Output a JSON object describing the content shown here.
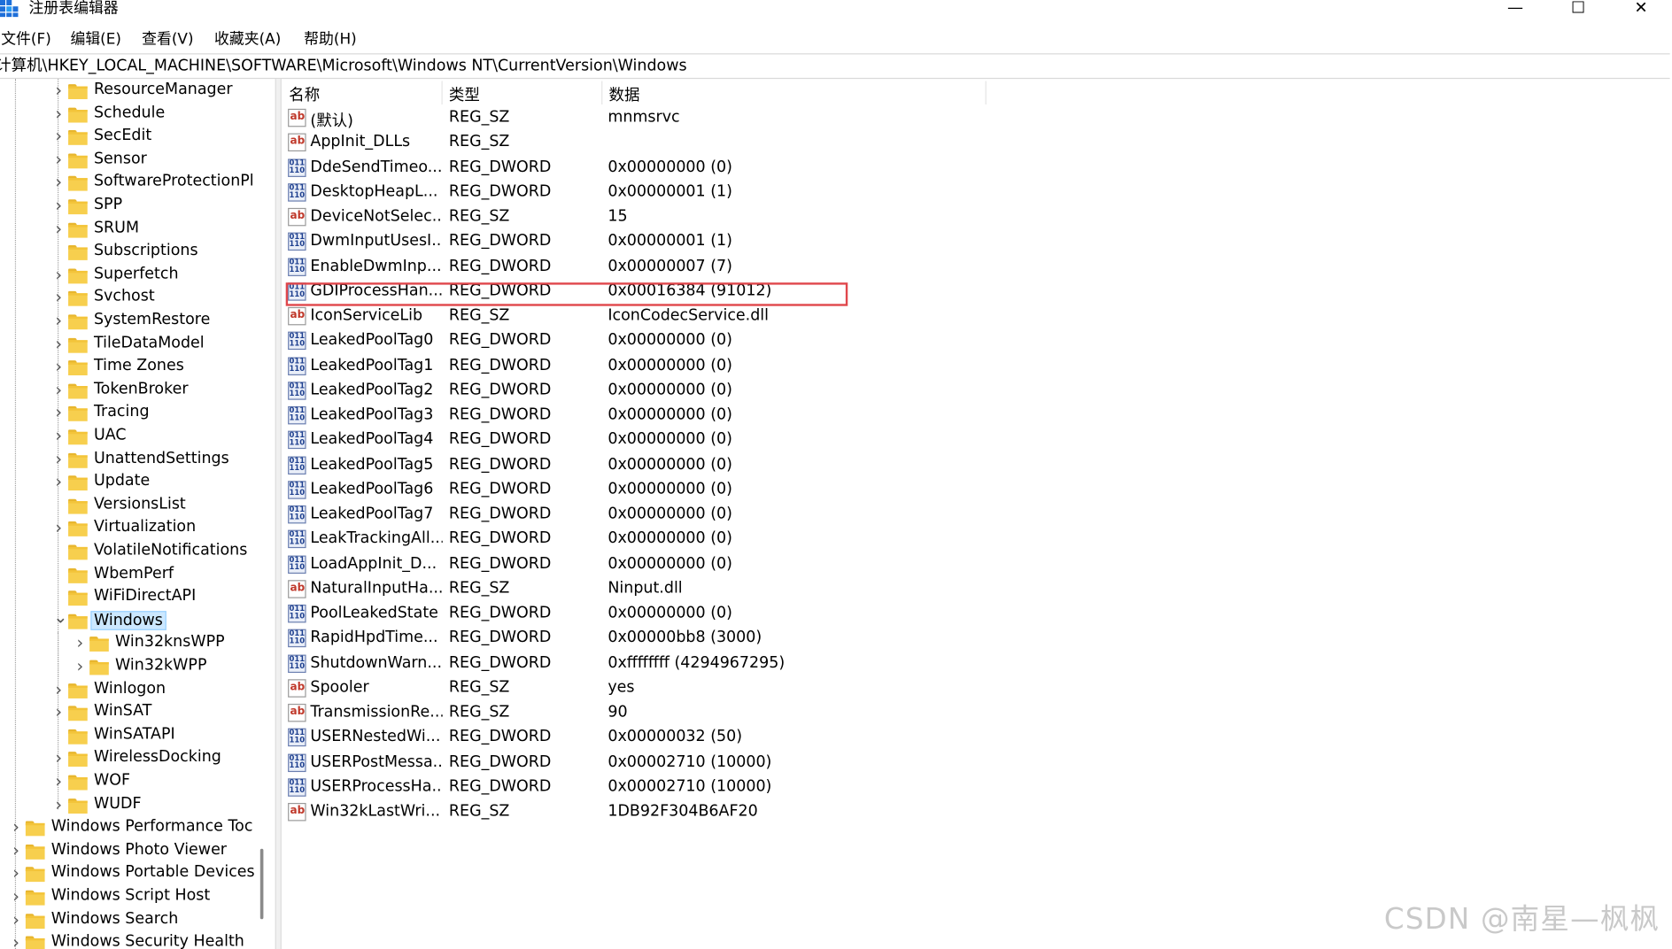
{
  "window": {
    "title": "注册表编辑器",
    "minimize": "—",
    "maximize": "☐",
    "close": "✕"
  },
  "menu": [
    "文件(F)",
    "编辑(E)",
    "查看(V)",
    "收藏夹(A)",
    "帮助(H)"
  ],
  "address": "计算机\\HKEY_LOCAL_MACHINE\\SOFTWARE\\Microsoft\\Windows NT\\CurrentVersion\\Windows",
  "tree": [
    {
      "label": "ResourceManager",
      "chev": ">",
      "indent": 1
    },
    {
      "label": "Schedule",
      "chev": ">",
      "indent": 1
    },
    {
      "label": "SecEdit",
      "chev": ">",
      "indent": 1
    },
    {
      "label": "Sensor",
      "chev": ">",
      "indent": 1
    },
    {
      "label": "SoftwareProtectionPl",
      "chev": ">",
      "indent": 1
    },
    {
      "label": "SPP",
      "chev": ">",
      "indent": 1
    },
    {
      "label": "SRUM",
      "chev": ">",
      "indent": 1
    },
    {
      "label": "Subscriptions",
      "chev": "",
      "indent": 1
    },
    {
      "label": "Superfetch",
      "chev": ">",
      "indent": 1
    },
    {
      "label": "Svchost",
      "chev": ">",
      "indent": 1
    },
    {
      "label": "SystemRestore",
      "chev": ">",
      "indent": 1
    },
    {
      "label": "TileDataModel",
      "chev": ">",
      "indent": 1
    },
    {
      "label": "Time Zones",
      "chev": ">",
      "indent": 1
    },
    {
      "label": "TokenBroker",
      "chev": ">",
      "indent": 1
    },
    {
      "label": "Tracing",
      "chev": ">",
      "indent": 1
    },
    {
      "label": "UAC",
      "chev": ">",
      "indent": 1
    },
    {
      "label": "UnattendSettings",
      "chev": ">",
      "indent": 1
    },
    {
      "label": "Update",
      "chev": ">",
      "indent": 1
    },
    {
      "label": "VersionsList",
      "chev": "",
      "indent": 1
    },
    {
      "label": "Virtualization",
      "chev": ">",
      "indent": 1
    },
    {
      "label": "VolatileNotifications",
      "chev": "",
      "indent": 1
    },
    {
      "label": "WbemPerf",
      "chev": "",
      "indent": 1
    },
    {
      "label": "WiFiDirectAPI",
      "chev": "",
      "indent": 1
    },
    {
      "label": "Windows",
      "chev": "v",
      "indent": 1,
      "selected": true
    },
    {
      "label": "Win32knsWPP",
      "chev": ">",
      "indent": 2
    },
    {
      "label": "Win32kWPP",
      "chev": ">",
      "indent": 2
    },
    {
      "label": "Winlogon",
      "chev": ">",
      "indent": 1
    },
    {
      "label": "WinSAT",
      "chev": ">",
      "indent": 1
    },
    {
      "label": "WinSATAPI",
      "chev": "",
      "indent": 1
    },
    {
      "label": "WirelessDocking",
      "chev": ">",
      "indent": 1
    },
    {
      "label": "WOF",
      "chev": ">",
      "indent": 1
    },
    {
      "label": "WUDF",
      "chev": ">",
      "indent": 1
    },
    {
      "label": "Windows Performance Toc",
      "chev": ">",
      "indent": 0
    },
    {
      "label": "Windows Photo Viewer",
      "chev": ">",
      "indent": 0
    },
    {
      "label": "Windows Portable Devices",
      "chev": ">",
      "indent": 0
    },
    {
      "label": "Windows Script Host",
      "chev": ">",
      "indent": 0
    },
    {
      "label": "Windows Search",
      "chev": ">",
      "indent": 0
    },
    {
      "label": "Windows Security Health",
      "chev": ">",
      "indent": 0
    }
  ],
  "columns": {
    "name": "名称",
    "type": "类型",
    "data": "数据"
  },
  "values": [
    {
      "name": "(默认)",
      "type": "REG_SZ",
      "data": "mnmsrvc",
      "icon": "sz"
    },
    {
      "name": "AppInit_DLLs",
      "type": "REG_SZ",
      "data": "",
      "icon": "sz"
    },
    {
      "name": "DdeSendTimeo...",
      "type": "REG_DWORD",
      "data": "0x00000000 (0)",
      "icon": "dw"
    },
    {
      "name": "DesktopHeapL...",
      "type": "REG_DWORD",
      "data": "0x00000001 (1)",
      "icon": "dw"
    },
    {
      "name": "DeviceNotSelec...",
      "type": "REG_SZ",
      "data": "15",
      "icon": "sz"
    },
    {
      "name": "DwmInputUsesI...",
      "type": "REG_DWORD",
      "data": "0x00000001 (1)",
      "icon": "dw"
    },
    {
      "name": "EnableDwmInp...",
      "type": "REG_DWORD",
      "data": "0x00000007 (7)",
      "icon": "dw"
    },
    {
      "name": "GDIProcessHan...",
      "type": "REG_DWORD",
      "data": "0x00016384 (91012)",
      "icon": "dw",
      "highlight": true
    },
    {
      "name": "IconServiceLib",
      "type": "REG_SZ",
      "data": "IconCodecService.dll",
      "icon": "sz"
    },
    {
      "name": "LeakedPoolTag0",
      "type": "REG_DWORD",
      "data": "0x00000000 (0)",
      "icon": "dw"
    },
    {
      "name": "LeakedPoolTag1",
      "type": "REG_DWORD",
      "data": "0x00000000 (0)",
      "icon": "dw"
    },
    {
      "name": "LeakedPoolTag2",
      "type": "REG_DWORD",
      "data": "0x00000000 (0)",
      "icon": "dw"
    },
    {
      "name": "LeakedPoolTag3",
      "type": "REG_DWORD",
      "data": "0x00000000 (0)",
      "icon": "dw"
    },
    {
      "name": "LeakedPoolTag4",
      "type": "REG_DWORD",
      "data": "0x00000000 (0)",
      "icon": "dw"
    },
    {
      "name": "LeakedPoolTag5",
      "type": "REG_DWORD",
      "data": "0x00000000 (0)",
      "icon": "dw"
    },
    {
      "name": "LeakedPoolTag6",
      "type": "REG_DWORD",
      "data": "0x00000000 (0)",
      "icon": "dw"
    },
    {
      "name": "LeakedPoolTag7",
      "type": "REG_DWORD",
      "data": "0x00000000 (0)",
      "icon": "dw"
    },
    {
      "name": "LeakTrackingAll...",
      "type": "REG_DWORD",
      "data": "0x00000000 (0)",
      "icon": "dw"
    },
    {
      "name": "LoadAppInit_D...",
      "type": "REG_DWORD",
      "data": "0x00000000 (0)",
      "icon": "dw"
    },
    {
      "name": "NaturalInputHa...",
      "type": "REG_SZ",
      "data": "Ninput.dll",
      "icon": "sz"
    },
    {
      "name": "PoolLeakedState",
      "type": "REG_DWORD",
      "data": "0x00000000 (0)",
      "icon": "dw"
    },
    {
      "name": "RapidHpdTime...",
      "type": "REG_DWORD",
      "data": "0x00000bb8 (3000)",
      "icon": "dw"
    },
    {
      "name": "ShutdownWarn...",
      "type": "REG_DWORD",
      "data": "0xffffffff (4294967295)",
      "icon": "dw"
    },
    {
      "name": "Spooler",
      "type": "REG_SZ",
      "data": "yes",
      "icon": "sz"
    },
    {
      "name": "TransmissionRe...",
      "type": "REG_SZ",
      "data": "90",
      "icon": "sz"
    },
    {
      "name": "USERNestedWi...",
      "type": "REG_DWORD",
      "data": "0x00000032 (50)",
      "icon": "dw"
    },
    {
      "name": "USERPostMessa...",
      "type": "REG_DWORD",
      "data": "0x00002710 (10000)",
      "icon": "dw"
    },
    {
      "name": "USERProcessHa...",
      "type": "REG_DWORD",
      "data": "0x00002710 (10000)",
      "icon": "dw"
    },
    {
      "name": "Win32kLastWri...",
      "type": "REG_SZ",
      "data": "1DB92F304B6AF20",
      "icon": "sz"
    }
  ],
  "icons": {
    "sz": "ab",
    "dw": "011\n110"
  },
  "watermark": "CSDN @南星—枫枫",
  "colors": {
    "highlight": "#e0474c",
    "selection": "#cce8ff",
    "folder": "#f7cf4e"
  }
}
